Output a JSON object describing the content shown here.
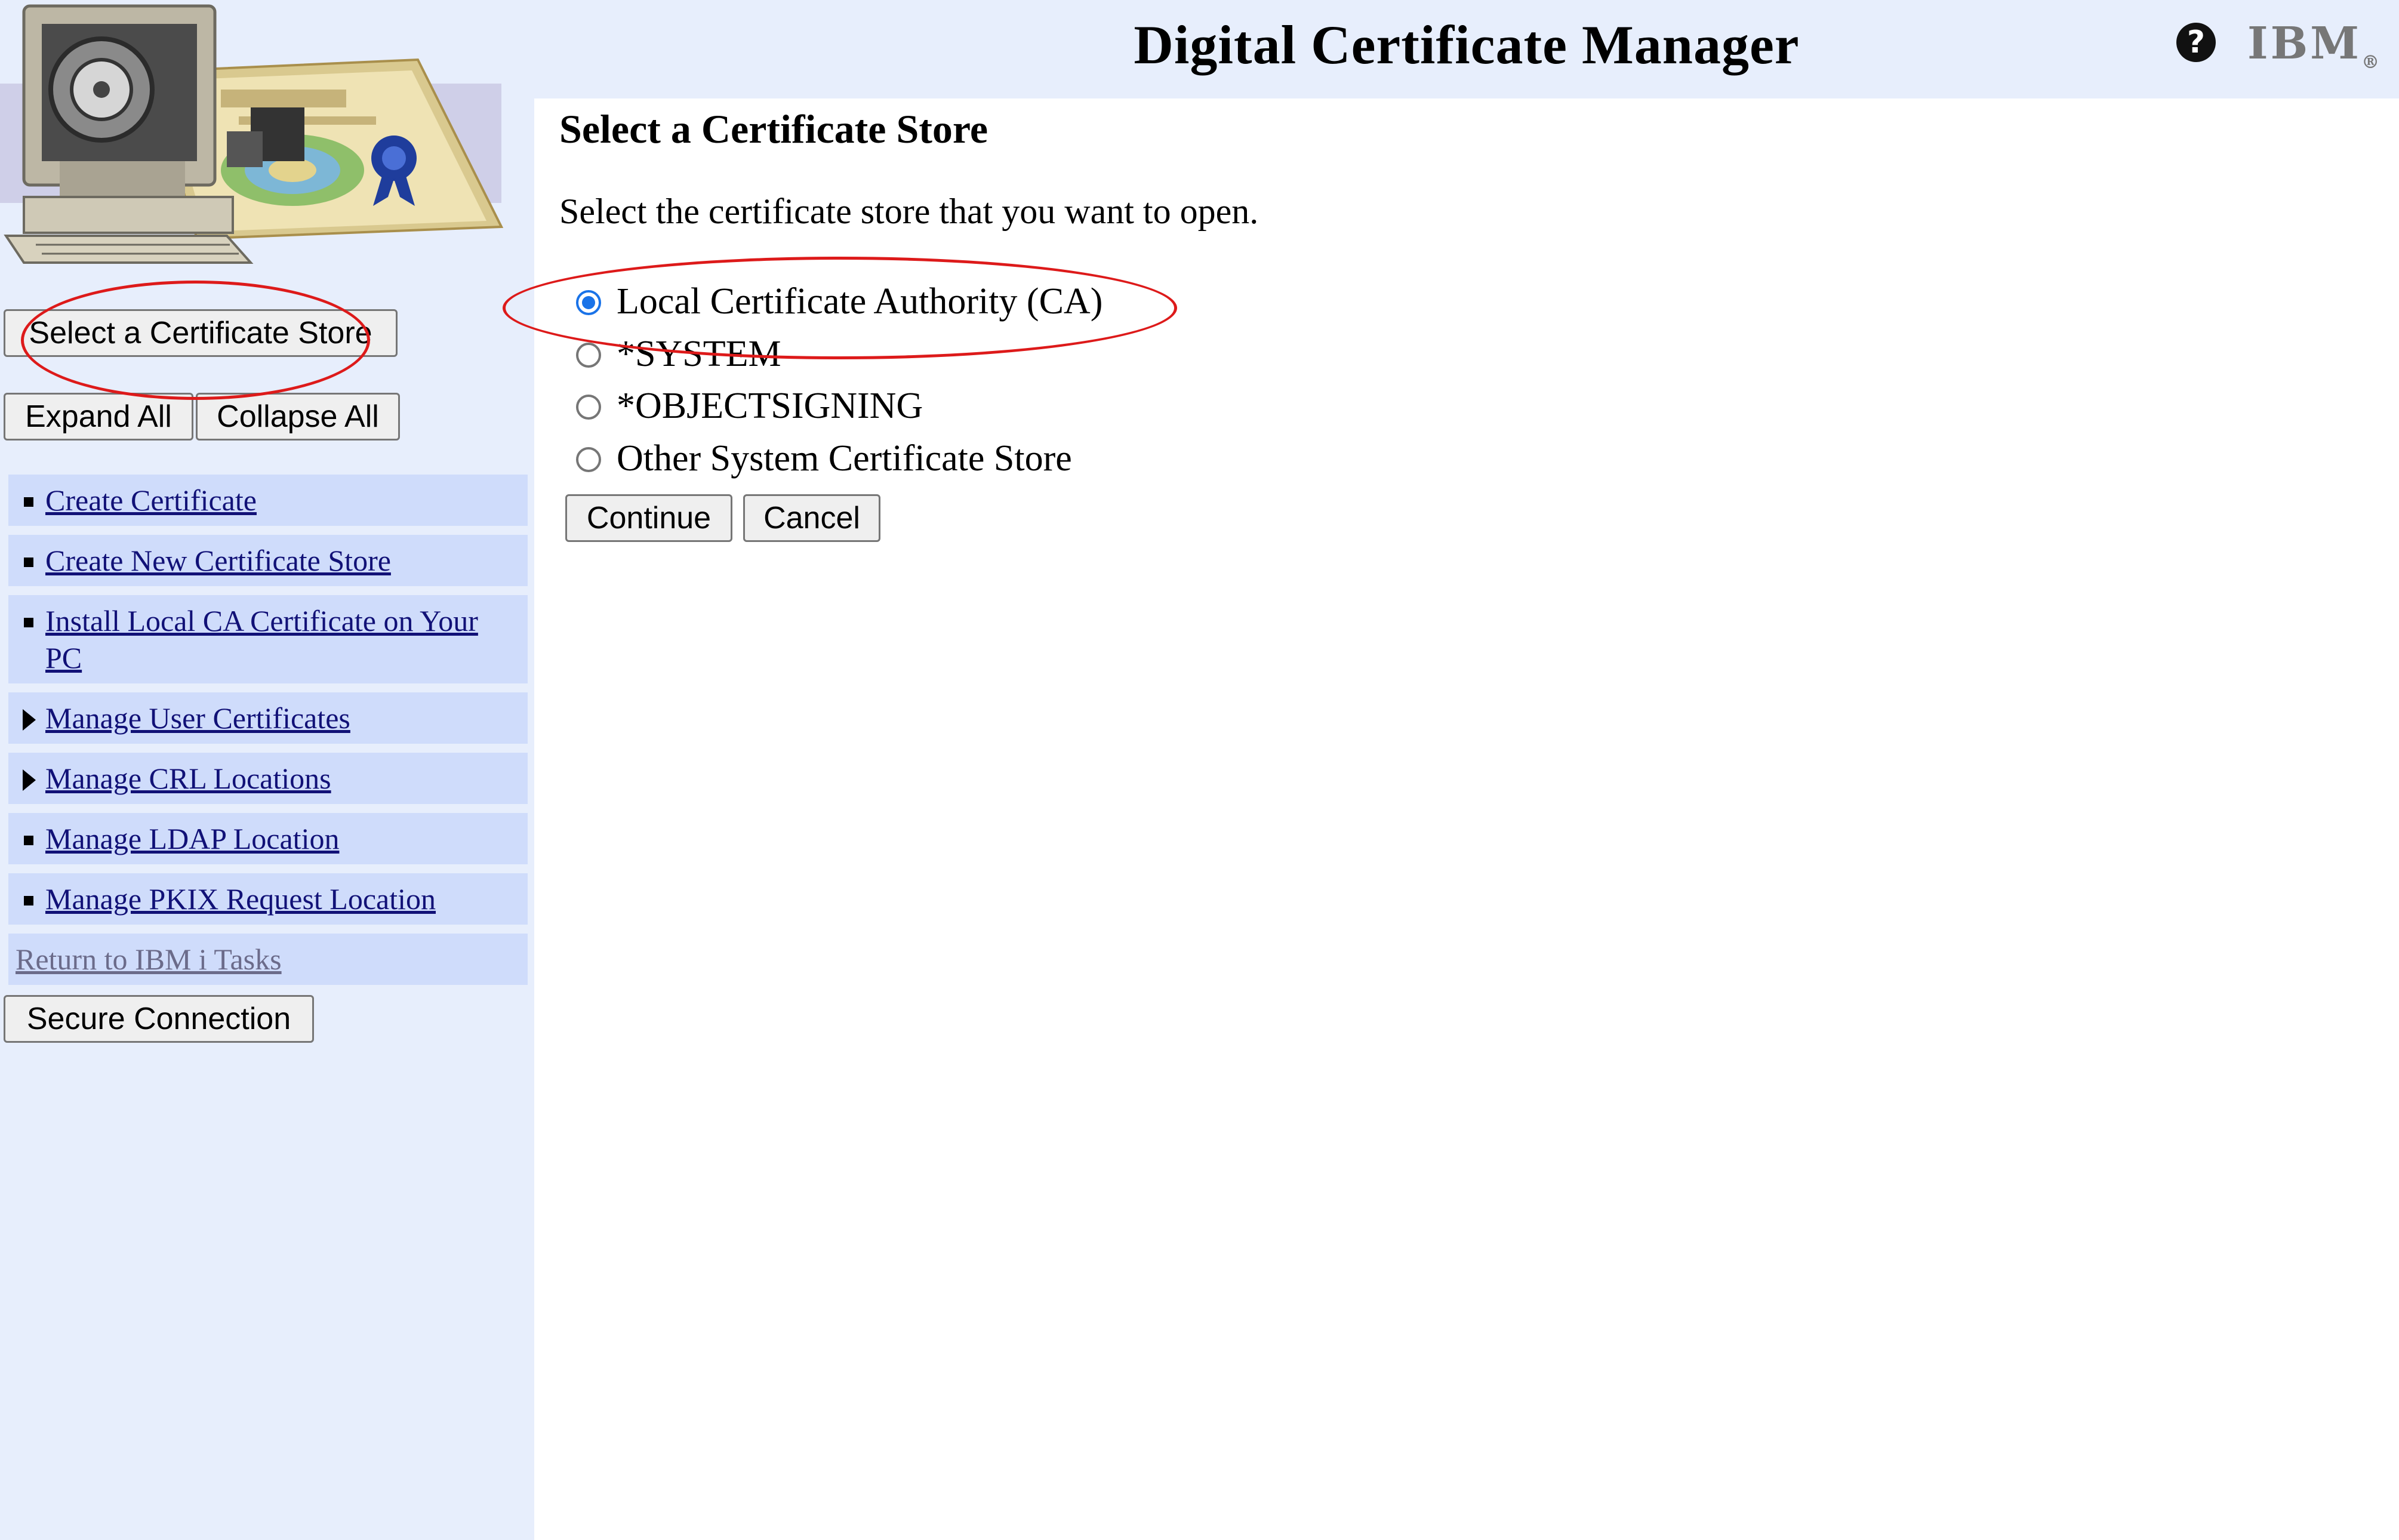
{
  "header": {
    "title": "Digital Certificate Manager",
    "help_icon": "help-icon",
    "logo_text": "IBM",
    "logo_mark": "®"
  },
  "sidebar": {
    "select_store_button": "Select a Certificate Store",
    "expand_all_button": "Expand All",
    "collapse_all_button": "Collapse All",
    "items": [
      {
        "label": "Create Certificate",
        "marker": "square-bullet"
      },
      {
        "label": "Create New Certificate Store",
        "marker": "square-bullet"
      },
      {
        "label": "Install Local CA Certificate on Your PC",
        "marker": "square-bullet"
      },
      {
        "label": "Manage User Certificates",
        "marker": "expand-triangle"
      },
      {
        "label": "Manage CRL Locations",
        "marker": "expand-triangle"
      },
      {
        "label": "Manage LDAP Location",
        "marker": "square-bullet"
      },
      {
        "label": "Manage PKIX Request Location",
        "marker": "square-bullet"
      }
    ],
    "return_link": "Return to IBM i Tasks",
    "secure_connection_button": "Secure Connection"
  },
  "main": {
    "title": "Select a Certificate Store",
    "description": "Select the certificate store that you want to open.",
    "options": [
      {
        "label": "Local Certificate Authority (CA)",
        "selected": true
      },
      {
        "label": "*SYSTEM",
        "selected": false
      },
      {
        "label": "*OBJECTSIGNING",
        "selected": false
      },
      {
        "label": "Other System Certificate Store",
        "selected": false
      }
    ],
    "continue_button": "Continue",
    "cancel_button": "Cancel"
  },
  "colors": {
    "panel_background": "#e7eefc",
    "nav_item_background": "#cfdcfb",
    "annotation_red": "#dd1a1a",
    "radio_selected": "#1a73e8"
  }
}
